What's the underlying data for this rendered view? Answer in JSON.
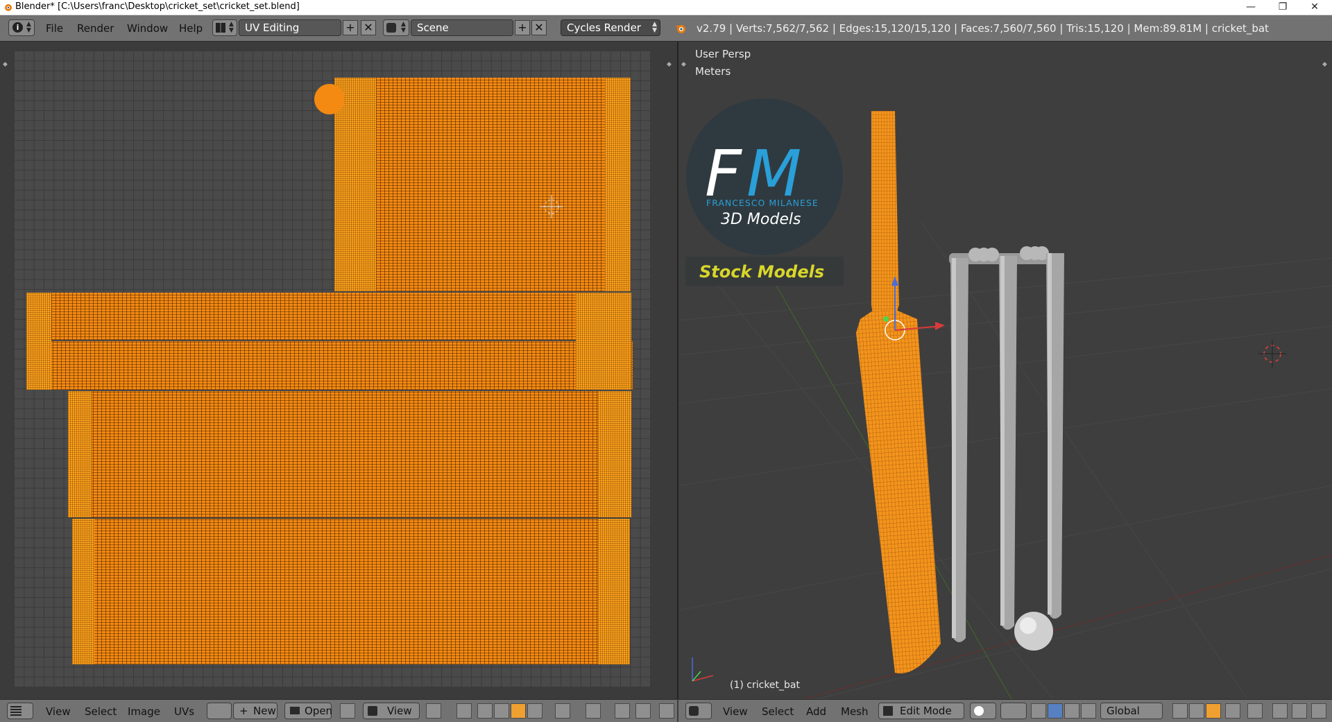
{
  "window": {
    "title": "Blender* [C:\\Users\\franc\\Desktop\\cricket_set\\cricket_set.blend]",
    "minimize": "—",
    "restore": "❐",
    "close": "✕"
  },
  "topbar": {
    "menus": [
      "File",
      "Render",
      "Window",
      "Help"
    ],
    "layout_name": "UV Editing",
    "scene_name": "Scene",
    "render_engine": "Cycles Render",
    "stats": "v2.79 | Verts:7,562/7,562 | Edges:15,120/15,120 | Faces:7,560/7,560 | Tris:15,120 | Mem:89.81M | cricket_bat"
  },
  "viewport": {
    "view_name": "User Persp",
    "units": "Meters",
    "object_label": "(1) cricket_bat",
    "logo": {
      "initials_f": "F",
      "initials_m": "M",
      "author": "FRANCESCO MILANESE",
      "tagline": "3D Models",
      "banner": "Stock Models"
    }
  },
  "uv_footer": {
    "menus": [
      "View",
      "Select",
      "Image",
      "UVs"
    ],
    "new_label": "New",
    "open_label": "Open",
    "view_label": "View"
  },
  "view3d_footer": {
    "menus": [
      "View",
      "Select",
      "Add",
      "Mesh"
    ],
    "mode": "Edit Mode",
    "orientation": "Global"
  },
  "colors": {
    "accent_orange": "#f48a12",
    "header_gray": "#727272",
    "logo_blue": "#2a9fd8",
    "banner_yellow": "#d8d62a"
  }
}
